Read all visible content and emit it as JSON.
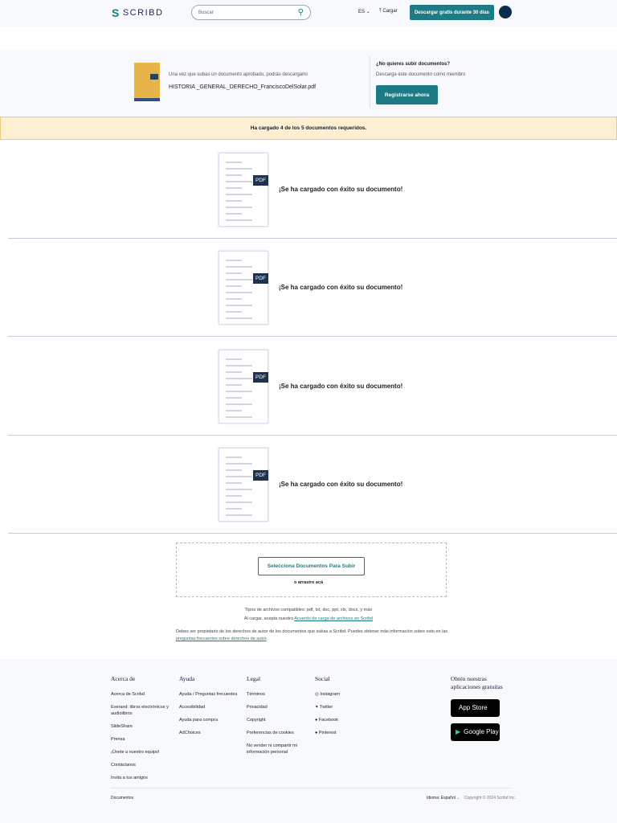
{
  "header": {
    "logo": "SCRIBD",
    "search_placeholder": "Buscar",
    "lang": "ES",
    "upload": "Cargar",
    "cta": "Descargar gratis durante 30 días"
  },
  "info": {
    "hint": "Una vez que subas un documento aprobado, podrás descargarlo",
    "filename": "HISTORIA _GENERAL_DERECHO_FranciscoDelSolar.pdf",
    "question": "¿No quieres subir documentos?",
    "subtext": "Descarga este documento como miembro",
    "register": "Registrarse ahora"
  },
  "banner": "Ha cargado 4 de los 5 documentos requeridos.",
  "uploads": [
    {
      "badge": "PDF",
      "message": "¡Se ha cargado con éxito su documento!"
    },
    {
      "badge": "PDF",
      "message": "¡Se ha cargado con éxito su documento!"
    },
    {
      "badge": "PDF",
      "message": "¡Se ha cargado con éxito su documento!"
    },
    {
      "badge": "PDF",
      "message": "¡Se ha cargado con éxito su documento!"
    }
  ],
  "dropzone": {
    "button": "Selecciona Documentos Para Subir",
    "drag": "o arrastre acá"
  },
  "notes": {
    "types": "Tipos de archivos compatibles: pdf, txt, doc, ppt, xls, docx, y más",
    "agree": "Al cargar, acepta nuestro ",
    "agree_link": "Acuerdo de carga de archivos en Scribd",
    "rights": "Debes ser propietario de los derechos de autor de los documentos que subas a Scribd. Puedes obtener más información sobre esto en las ",
    "rights_link": "preguntas frecuentes sobre derechos de autor",
    "period": "."
  },
  "footer": {
    "about": {
      "title": "Acerca de",
      "items": [
        "Acerca de Scribd",
        "Everand: libros electrónicos y audiolibros",
        "SlideShare",
        "Prensa",
        "¡Únete a nuestro equipo!",
        "Contáctanos",
        "Invita a tus amigos"
      ]
    },
    "help": {
      "title": "Ayuda",
      "items": [
        "Ayuda / Preguntas frecuentes",
        "Accesibilidad",
        "Ayuda para compra",
        "AdChoices"
      ]
    },
    "legal": {
      "title": "Legal",
      "items": [
        "Términos",
        "Privacidad",
        "Copyright",
        "Preferencias de cookies",
        "No vender ni compartir mi información personal"
      ]
    },
    "social": {
      "title": "Social",
      "items": [
        "Instagram",
        "Twitter",
        "Facebook",
        "Pinterest"
      ]
    },
    "apps": {
      "title": "Obtén nuestras aplicaciones gratuitas",
      "appstore": "App Store",
      "googleplay": "Google Play"
    },
    "documents": "Documentos",
    "language": "Idioma: Español",
    "copyright": "Copyright © 2024 Scribd Inc."
  }
}
